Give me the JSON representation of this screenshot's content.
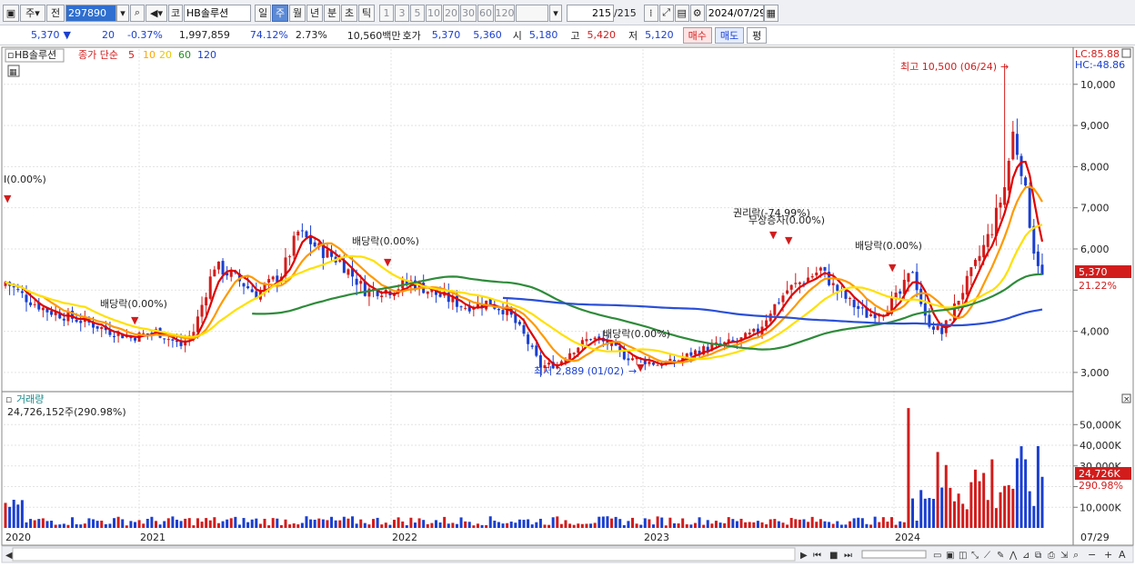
{
  "toolbar": {
    "market_label": "주",
    "price_label": "전",
    "code": "297890",
    "name": "HB솔루션",
    "kospi_label": "코",
    "period_buttons": [
      "일",
      "주",
      "월",
      "년",
      "분",
      "초",
      "틱"
    ],
    "selected_period": "주",
    "interval_buttons": [
      "1",
      "3",
      "5",
      "10",
      "20",
      "30",
      "60",
      "120"
    ],
    "count": "215",
    "count_total": "/215",
    "date": "2024/07/29"
  },
  "quote": {
    "price": "5,370",
    "direction": "▼",
    "change": "20",
    "change_pct": "-0.37%",
    "volume": "1,997,859",
    "volume_ratio": "74.12%",
    "turnover": "2.73%",
    "amount": "10,560백만",
    "ask_label": "호가",
    "ask": "5,370",
    "bid": "5,360",
    "open_label": "시",
    "open": "5,180",
    "high_label": "고",
    "high": "5,420",
    "low_label": "저",
    "low": "5,120",
    "buy_label": "매수",
    "sell_label": "매도",
    "avg_label": "평"
  },
  "legend": {
    "stock": "HB솔루션",
    "ma_title": "종가 단순",
    "periods": [
      "5",
      "10",
      "20",
      "60",
      "120"
    ],
    "colors": {
      "5": "#e00000",
      "10": "#ffa500",
      "20": "#ffd700",
      "60": "#228b22",
      "120": "#1a3fd0"
    }
  },
  "annotations": {
    "lc": "LC:85.88",
    "hc": "HC:-48.86",
    "high": "최고 10,500 (06/24)",
    "low": "최저 2,889 (01/02)",
    "left_edge": "I(0.00%)",
    "div_2020": "배당락(0.00%)",
    "div_2021": "배당락(0.00%)",
    "div_2022": "배당락(0.00%)",
    "rights": "권리락(-74.99%)",
    "bonus": "무상증자(0.00%)",
    "div_2023": "배당락(0.00%)",
    "price_tag": "5,370",
    "pct_tag": "21.22%",
    "vol_tag": "24,726K",
    "vol_pct_tag": "290.98%"
  },
  "volume_panel": {
    "title": "거래량",
    "value": "24,726,152주(290.98%)"
  },
  "x_labels": [
    "2020",
    "2021",
    "2022",
    "2023",
    "2024"
  ],
  "x_last_label": "07/29",
  "chart_data": {
    "type": "candlestick",
    "price_axis": {
      "min": 2600,
      "max": 10900,
      "ticks": [
        3000,
        4000,
        5000,
        6000,
        7000,
        8000,
        9000,
        10000
      ],
      "tick_labels": [
        "3,000",
        "4,000",
        "",
        "6,000",
        "7,000",
        "8,000",
        "9,000",
        "10,000"
      ]
    },
    "volume_axis": {
      "min": 0,
      "max": 62000,
      "ticks": [
        10000,
        20000,
        30000,
        40000,
        50000
      ],
      "tick_labels": [
        "10,000K",
        "",
        "30,000K",
        "40,000K",
        "50,000K"
      ]
    },
    "high": 10500,
    "low": 2889,
    "last_close": 5370,
    "last_volume_k": 24726,
    "close_path": [
      [
        0,
        5200
      ],
      [
        5,
        4800
      ],
      [
        10,
        4500
      ],
      [
        15,
        4350
      ],
      [
        20,
        4200
      ],
      [
        25,
        4000
      ],
      [
        30,
        3850
      ],
      [
        36,
        4000
      ],
      [
        42,
        3650
      ],
      [
        45,
        4000
      ],
      [
        50,
        5600
      ],
      [
        55,
        5300
      ],
      [
        60,
        4900
      ],
      [
        66,
        5400
      ],
      [
        70,
        6400
      ],
      [
        75,
        6000
      ],
      [
        80,
        5700
      ],
      [
        86,
        5000
      ],
      [
        92,
        5000
      ],
      [
        97,
        5200
      ],
      [
        103,
        4900
      ],
      [
        110,
        4600
      ],
      [
        115,
        4700
      ],
      [
        120,
        4500
      ],
      [
        124,
        3900
      ],
      [
        128,
        3150
      ],
      [
        132,
        3200
      ],
      [
        135,
        3500
      ],
      [
        140,
        3850
      ],
      [
        144,
        3700
      ],
      [
        148,
        3400
      ],
      [
        152,
        3300
      ],
      [
        156,
        3200
      ],
      [
        160,
        3250
      ],
      [
        165,
        3500
      ],
      [
        170,
        3650
      ],
      [
        175,
        3750
      ],
      [
        180,
        4000
      ],
      [
        183,
        4500
      ],
      [
        187,
        5000
      ],
      [
        192,
        5300
      ],
      [
        195,
        5500
      ],
      [
        198,
        5100
      ],
      [
        202,
        4700
      ],
      [
        206,
        4400
      ],
      [
        210,
        4500
      ],
      [
        214,
        4900
      ],
      [
        217,
        5500
      ],
      [
        220,
        4300
      ],
      [
        224,
        3950
      ],
      [
        228,
        4800
      ],
      [
        232,
        5600
      ],
      [
        236,
        6500
      ],
      [
        239,
        7500
      ],
      [
        241,
        8800
      ],
      [
        243,
        8000
      ],
      [
        246,
        6000
      ],
      [
        248,
        5370
      ]
    ],
    "price_series": [
      "HB솔루션"
    ],
    "ma_periods": [
      5,
      10,
      20,
      60,
      120
    ]
  }
}
